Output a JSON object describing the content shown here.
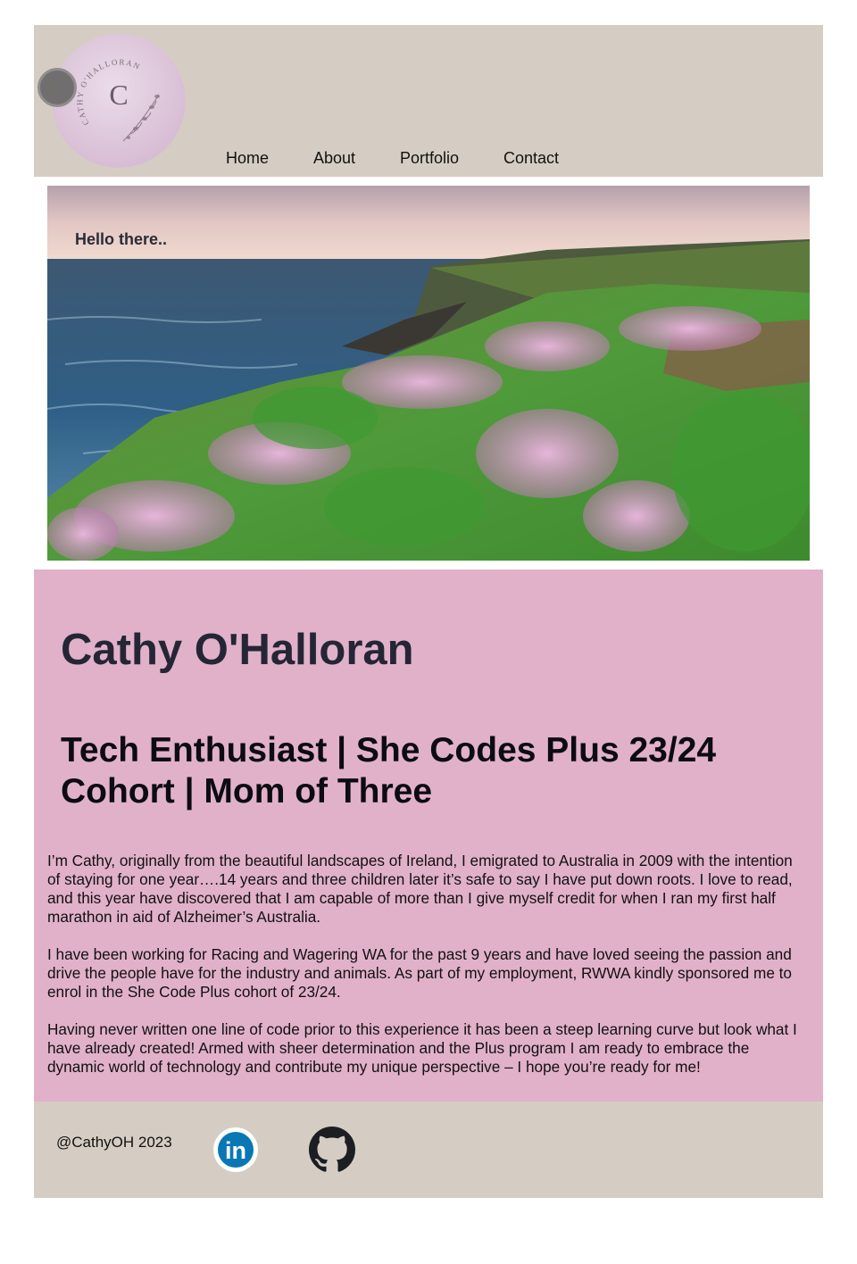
{
  "logo": {
    "letter": "C",
    "arc_text": "CATHY O'HALLORAN",
    "icon": "floral-monogram-logo"
  },
  "nav": {
    "items": [
      {
        "label": "Home"
      },
      {
        "label": "About"
      },
      {
        "label": "Portfolio"
      },
      {
        "label": "Contact"
      }
    ]
  },
  "hero": {
    "greeting": "Hello there..",
    "image": "coastal-cliffs-with-pink-flowers-photo"
  },
  "about": {
    "name": "Cathy O'Halloran",
    "tagline": "Tech Enthusiast | She Codes Plus 23/24 Cohort | Mom of Three",
    "paragraphs": [
      "I’m Cathy, originally from the beautiful landscapes of Ireland, I emigrated to Australia in 2009 with the intention of staying for one year….14 years and three children later it’s safe to say I have put down roots. I love to read, and this year have discovered that I am capable of more than I give myself credit for when I ran my first half marathon in aid of Alzheimer’s Australia.",
      "I have been working for Racing and Wagering WA for the past 9 years and have loved seeing the passion and drive the people have for the industry and animals. As part of my employment, RWWA kindly sponsored me to enrol in the She Code Plus cohort of 23/24.",
      "Having never written one line of code prior to this experience it has been a steep learning curve but look what I have already created! Armed with sheer determination and the Plus program I am ready to embrace the dynamic world of technology and contribute my unique perspective – I hope you’re ready for me!"
    ]
  },
  "footer": {
    "handle": "@CathyOH 2023",
    "social": [
      {
        "name": "linkedin-icon",
        "text": "in",
        "color": "#0a66c2"
      },
      {
        "name": "github-icon",
        "color": "#1b1f23"
      }
    ]
  },
  "colors": {
    "header_bg": "#d5cdc3",
    "about_bg": "#e1b1ca",
    "footer_bg": "#d5cdc3"
  }
}
